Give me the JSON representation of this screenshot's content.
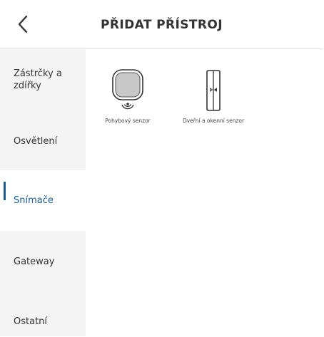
{
  "header": {
    "title": "PŘIDAT PŘÍSTROJ",
    "back_icon": "chevron-left-icon"
  },
  "sidebar": {
    "items": [
      {
        "label": "Zástrčky a zdířky",
        "active": false
      },
      {
        "label": "Osvětlení",
        "active": false
      },
      {
        "label": "Snímače",
        "active": true
      },
      {
        "label": "Gateway",
        "active": false
      },
      {
        "label": "Ostatní",
        "active": false
      }
    ]
  },
  "devices": [
    {
      "label": "Pohybový senzor",
      "icon": "motion-sensor-icon"
    },
    {
      "label": "Dveřní a okenní senzor",
      "icon": "door-window-sensor-icon"
    }
  ],
  "colors": {
    "accent": "#1d5b8f",
    "sidebar_bg": "#f4f4f4",
    "sensor_fill": "#c8c8c8"
  }
}
